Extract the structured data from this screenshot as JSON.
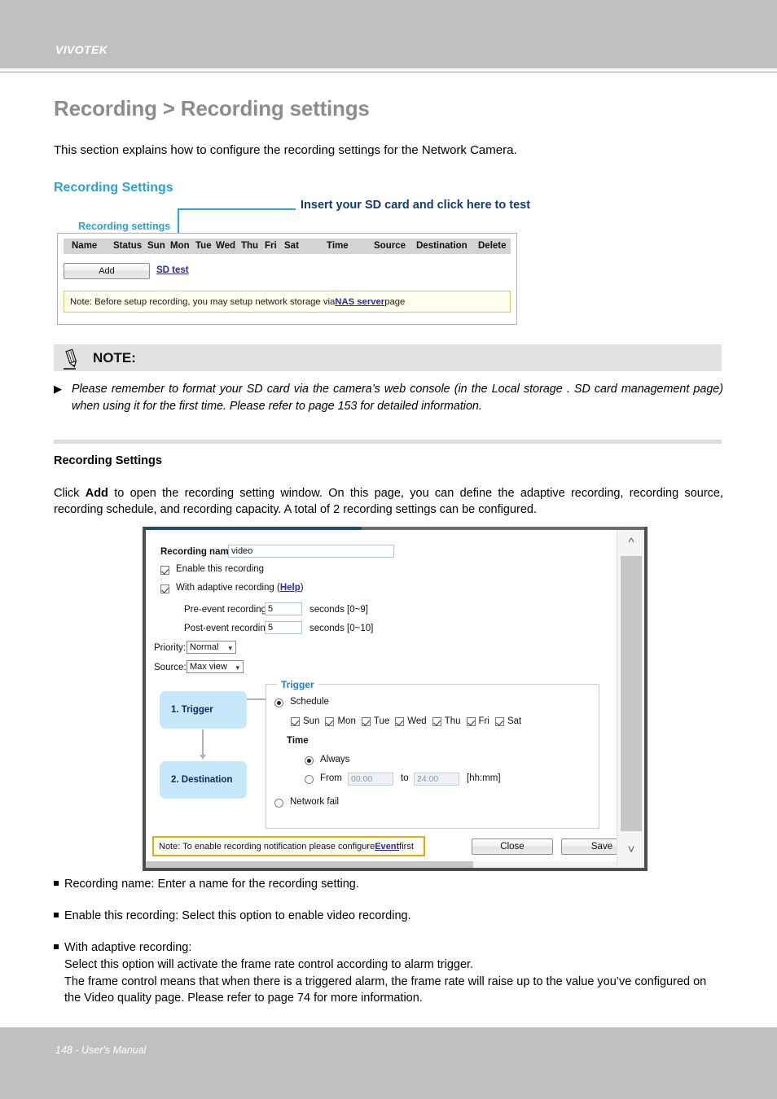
{
  "brand": "VIVOTEK",
  "page_title": "Recording > Recording settings",
  "intro": "This section explains how to configure the recording settings for the Network Camera.",
  "section_heading": "Recording Settings",
  "callout": "Insert your SD card and click here to test",
  "recording_panel": {
    "legend": "Recording settings",
    "columns": [
      "Name",
      "Status",
      "Sun",
      "Mon",
      "Tue",
      "Wed",
      "Thu",
      "Fri",
      "Sat",
      "Time",
      "Source",
      "Destination",
      "Delete"
    ],
    "add_button": "Add",
    "sd_test_link": "SD test",
    "note_prefix": "Note: Before setup recording, you may setup network storage via ",
    "note_link": "NAS server",
    "note_suffix": " page"
  },
  "note_block": {
    "title": "NOTE:",
    "arrow": "▶",
    "body": "Please remember to format your SD card via the camera’s web console (in the Local storage . SD card management page) when using it for the first time. Please refer to page 153 for detailed information."
  },
  "sub_heading": "Recording Settings",
  "body_paragraph_parts": {
    "p1": "Click ",
    "bold": "Add",
    "p2": " to open the recording setting window. On this page, you can define the adaptive recording, recording source, recording schedule, and recording capacity. A total of 2 recording settings can be configured."
  },
  "dialog": {
    "recording_name_label": "Recording name:",
    "recording_name_value": "video",
    "enable_recording_label": "Enable this recording",
    "enable_recording_checked": true,
    "adaptive_label_prefix": "With adaptive recording (",
    "adaptive_help_link": "Help",
    "adaptive_label_suffix": ")",
    "adaptive_checked": true,
    "pre_event_label": "Pre-event recording:",
    "pre_event_value": "5",
    "pre_event_unit": "seconds [0~9]",
    "post_event_label": "Post-event recording:",
    "post_event_value": "5",
    "post_event_unit": "seconds [0~10]",
    "priority_label": "Priority:",
    "priority_value": "Normal",
    "source_label": "Source:",
    "source_value": "Max view",
    "flow": {
      "step1": "1.  Trigger",
      "step2": "2.  Destination"
    },
    "trigger": {
      "legend": "Trigger",
      "schedule_label": "Schedule",
      "schedule_selected": true,
      "days": [
        "Sun",
        "Mon",
        "Tue",
        "Wed",
        "Thu",
        "Fri",
        "Sat"
      ],
      "time_label": "Time",
      "always_label": "Always",
      "always_selected": true,
      "from_label": "From",
      "from_value": "00:00",
      "to_label": "to",
      "to_value": "24:00",
      "time_format": "[hh:mm]",
      "network_fail_label": "Network fail"
    },
    "note_prefix": "Note: To enable recording notification please configure ",
    "note_link": "Event",
    "note_suffix": " first",
    "close_button": "Close",
    "save_button": "Save"
  },
  "bullets": [
    {
      "line1": "Recording name: Enter a name for the recording setting.",
      "lines": []
    },
    {
      "line1": "Enable this recording: Select this option to enable video recording.",
      "lines": []
    },
    {
      "line1": "With adaptive recording:",
      "lines": [
        "Select this option will activate the frame rate control according to alarm trigger.",
        "The frame control means that when there is a triggered alarm, the frame rate will raise up to the value you’ve configured on the Video quality page. Please refer to page 74 for more information."
      ]
    }
  ],
  "footer": "148 - User's Manual",
  "colors": {
    "brand_bar": "#bfc0c0",
    "accent_blue": "#27a3d8",
    "callout_navy": "#123a75",
    "callout_line": "#29a3d4",
    "link": "#2a2aa5",
    "note_yellow_border": "#e3c967",
    "dialog_note_orange": "#f0a500",
    "flow_box": "#c5e8fb"
  }
}
